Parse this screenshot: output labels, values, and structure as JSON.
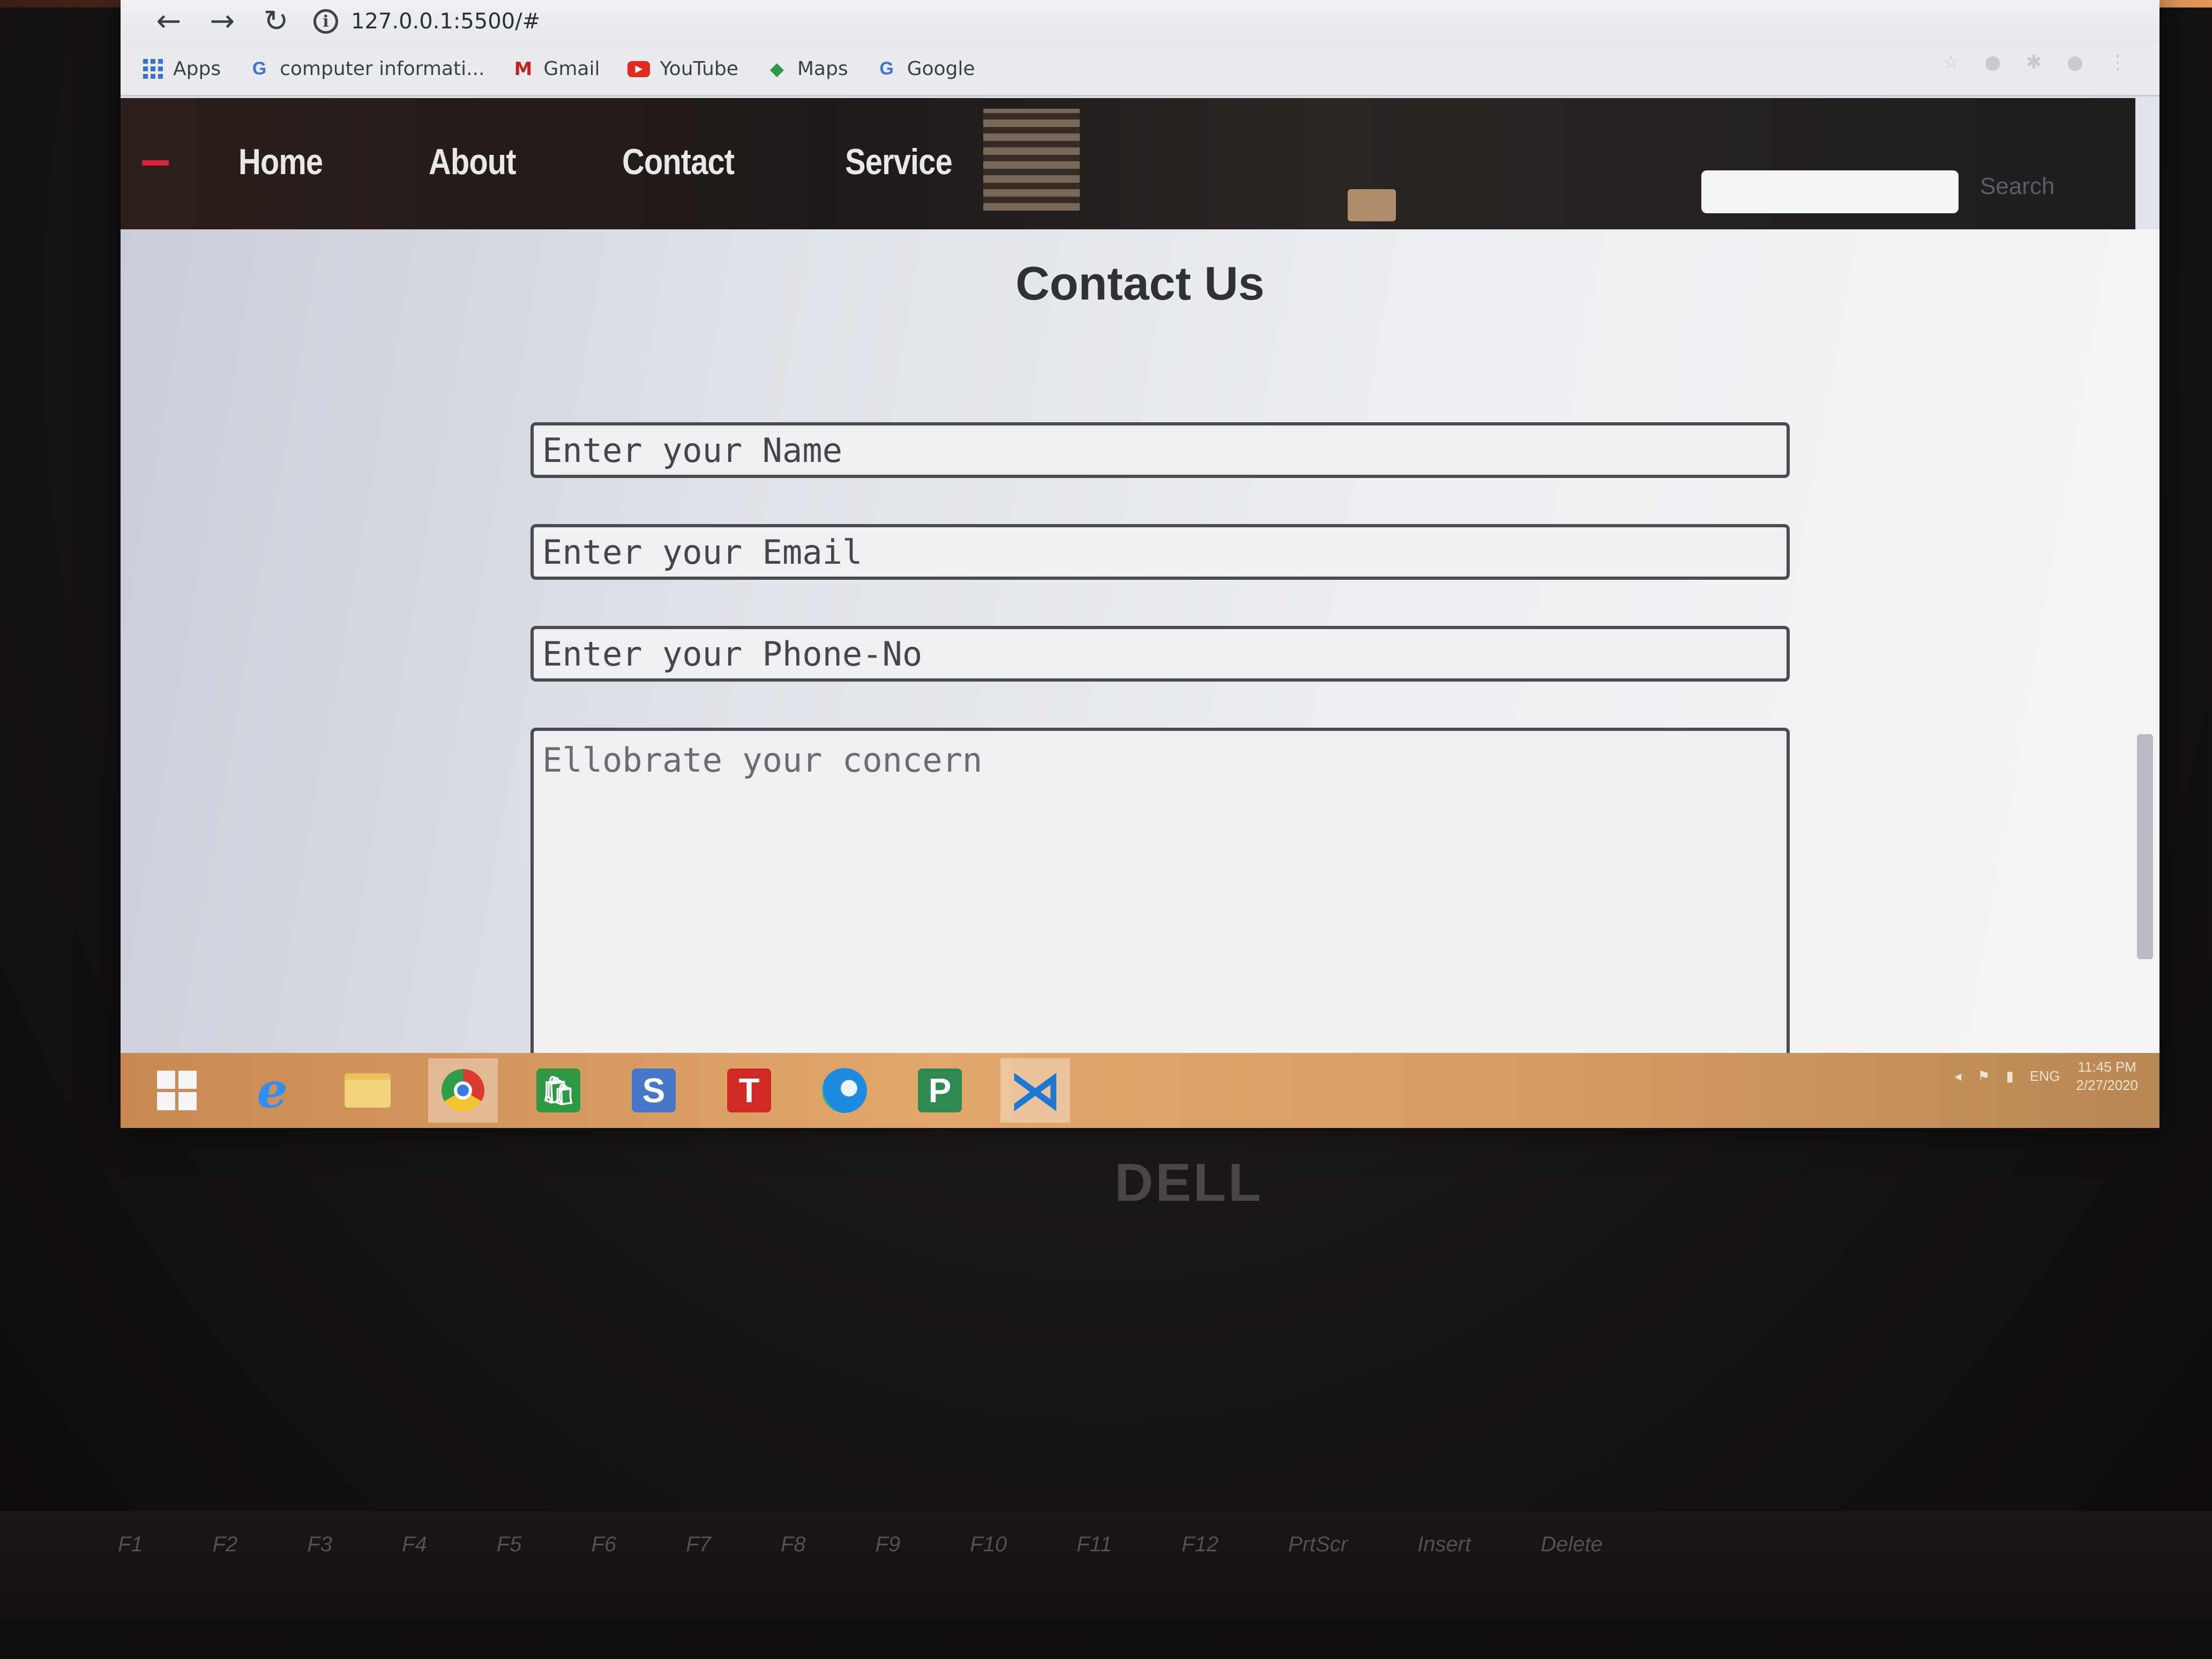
{
  "browser": {
    "back_icon": "back-arrow-icon",
    "forward_icon": "forward-arrow-icon",
    "reload_icon": "reload-icon",
    "url": "127.0.0.1:5500/#",
    "bookmarks": [
      {
        "label": "Apps",
        "icon": "apps-grid-icon"
      },
      {
        "label": "computer informati...",
        "icon": "google-icon"
      },
      {
        "label": "Gmail",
        "icon": "gmail-icon"
      },
      {
        "label": "YouTube",
        "icon": "youtube-icon"
      },
      {
        "label": "Maps",
        "icon": "maps-icon"
      },
      {
        "label": "Google",
        "icon": "google-icon"
      }
    ]
  },
  "site": {
    "nav": [
      "Home",
      "About",
      "Contact",
      "Service"
    ],
    "search_button": "Search",
    "search_placeholder": ""
  },
  "contact": {
    "title": "Contact Us",
    "name_placeholder": "Enter your Name",
    "email_placeholder": "Enter your Email",
    "phone_placeholder": "Enter your Phone-No",
    "concern_placeholder": "Ellobrate your concern"
  },
  "taskbar": {
    "apps": [
      "start-button",
      "internet-explorer",
      "file-explorer",
      "chrome",
      "store",
      "s-app",
      "t-app",
      "edge",
      "p-app",
      "vscode"
    ],
    "tray_lang": "ENG",
    "clock_time": "11:45 PM",
    "clock_date": "2/27/2020"
  },
  "device": {
    "brand": "DELL",
    "function_keys": [
      "F1",
      "F2",
      "F3",
      "F4",
      "F5",
      "F6",
      "F7",
      "F8",
      "F9",
      "F10",
      "F11",
      "F12",
      "PrtScr",
      "Insert",
      "Delete"
    ]
  },
  "colors": {
    "nav_text": "#e8e8e8",
    "accent_dash": "#d8213a",
    "taskbar": "#e2a76b"
  }
}
